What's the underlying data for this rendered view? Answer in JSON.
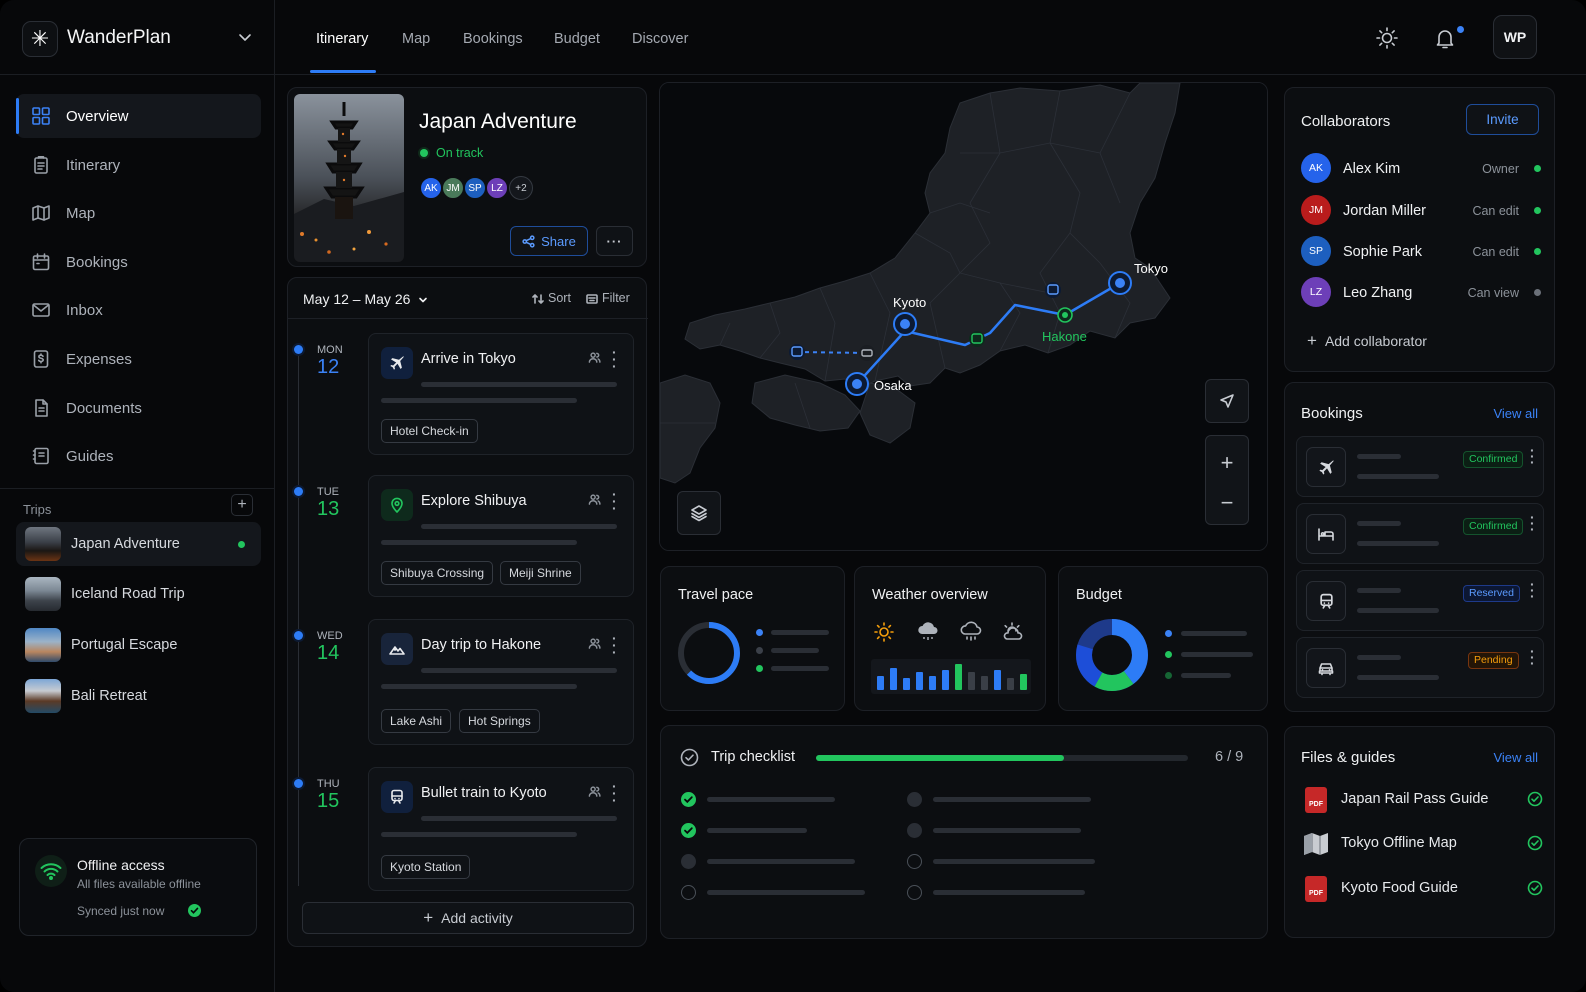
{
  "app": {
    "name": "WanderPlan",
    "user_initials": "WP"
  },
  "tabs": [
    {
      "label": "Itinerary",
      "active": true
    },
    {
      "label": "Map"
    },
    {
      "label": "Bookings"
    },
    {
      "label": "Budget"
    },
    {
      "label": "Discover"
    }
  ],
  "sidebar": {
    "nav": [
      {
        "label": "Overview",
        "icon": "grid-icon",
        "active": true
      },
      {
        "label": "Itinerary",
        "icon": "clipboard-icon"
      },
      {
        "label": "Map",
        "icon": "map-icon"
      },
      {
        "label": "Bookings",
        "icon": "calendar-icon"
      },
      {
        "label": "Inbox",
        "icon": "mail-icon"
      },
      {
        "label": "Expenses",
        "icon": "dollar-icon"
      },
      {
        "label": "Documents",
        "icon": "document-icon"
      },
      {
        "label": "Guides",
        "icon": "book-icon"
      }
    ],
    "trips_label": "Trips",
    "trips": [
      {
        "name": "Japan Adventure",
        "active": true
      },
      {
        "name": "Iceland Road Trip"
      },
      {
        "name": "Portugal Escape"
      },
      {
        "name": "Bali Retreat"
      }
    ],
    "offline": {
      "title": "Offline access",
      "subtitle": "All files available offline",
      "synced": "Synced just now"
    }
  },
  "trip_header": {
    "title": "Japan Adventure",
    "status": "On track",
    "avatars": [
      "AK",
      "JM",
      "SP",
      "LZ"
    ],
    "more_count": "+2",
    "share_label": "Share"
  },
  "itinerary": {
    "date_range": "May 12 – May 26",
    "sort_label": "Sort",
    "filter_label": "Filter",
    "days": [
      {
        "dow": "MON",
        "day": "12",
        "title": "Arrive in Tokyo",
        "icon": "plane-icon",
        "tags": [
          "Hotel Check-in"
        ]
      },
      {
        "dow": "TUE",
        "day": "13",
        "title": "Explore Shibuya",
        "icon": "map-pin-icon",
        "tags": [
          "Shibuya Crossing",
          "Meiji Shrine"
        ]
      },
      {
        "dow": "WED",
        "day": "14",
        "title": "Day trip to Hakone",
        "icon": "mountain-icon",
        "tags": [
          "Lake Ashi",
          "Hot Springs"
        ]
      },
      {
        "dow": "THU",
        "day": "15",
        "title": "Bullet train to Kyoto",
        "icon": "train-icon",
        "tags": [
          "Kyoto Station"
        ]
      }
    ],
    "add_label": "Add activity"
  },
  "map": {
    "cities": [
      "Tokyo",
      "Kyoto",
      "Osaka",
      "Hakone"
    ]
  },
  "widgets": {
    "travel_pace": {
      "title": "Travel pace"
    },
    "weather": {
      "title": "Weather overview",
      "icons": [
        "sun-icon",
        "cloud-rain-icon",
        "cloud-rain-icon",
        "partly-cloudy-icon"
      ]
    },
    "budget": {
      "title": "Budget"
    }
  },
  "checklist": {
    "title": "Trip checklist",
    "progress": "6 / 9",
    "done": 6,
    "total": 9
  },
  "collaborators": {
    "title": "Collaborators",
    "invite_label": "Invite",
    "people": [
      {
        "initials": "AK",
        "name": "Alex Kim",
        "role": "Owner",
        "color": "#2563eb"
      },
      {
        "initials": "JM",
        "name": "Jordan Miller",
        "role": "Can edit",
        "color": "#b91c1c"
      },
      {
        "initials": "SP",
        "name": "Sophie Park",
        "role": "Can edit",
        "color": "#1d5fbf"
      },
      {
        "initials": "LZ",
        "name": "Leo Zhang",
        "role": "Can view",
        "color": "#6d3fb8"
      }
    ],
    "add_label": "Add collaborator"
  },
  "bookings": {
    "title": "Bookings",
    "view_all": "View all",
    "items": [
      {
        "icon": "plane-icon",
        "status": "Confirmed"
      },
      {
        "icon": "bed-icon",
        "status": "Confirmed"
      },
      {
        "icon": "train-icon",
        "status": "Reserved"
      },
      {
        "icon": "car-icon",
        "status": "Pending"
      }
    ]
  },
  "files": {
    "title": "Files & guides",
    "view_all": "View all",
    "items": [
      {
        "name": "Japan Rail Pass Guide",
        "icon": "pdf-icon"
      },
      {
        "name": "Tokyo Offline Map",
        "icon": "folded-map-icon"
      },
      {
        "name": "Kyoto Food Guide",
        "icon": "pdf-icon"
      }
    ]
  },
  "colors": {
    "accent": "#2d7cf6",
    "success": "#22c55e",
    "warning": "#f59e0b",
    "background": "#07080a"
  }
}
